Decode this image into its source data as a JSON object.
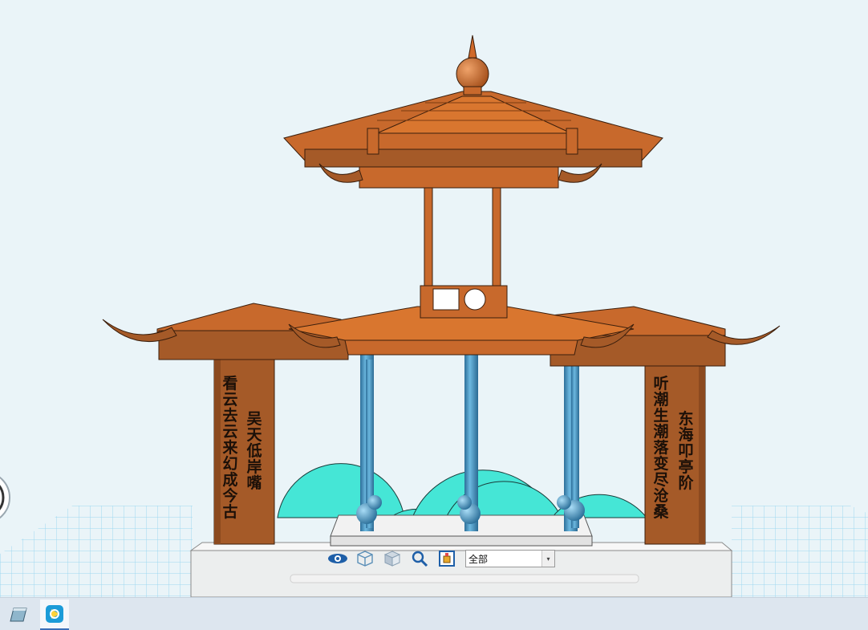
{
  "scene": {
    "model": "pavilion",
    "colors": {
      "background": "#eaf4f8",
      "roof": "#c8692c",
      "pillar_wood": "#a55a28",
      "column": "#3f8fbf",
      "hill": "#45e6d6",
      "grid": "#8fd3ee",
      "base": "#f0f2f2"
    },
    "couplets": {
      "left_outer": "看云去云来 幻成今古",
      "left_inner": "吴天低岸嘴",
      "right_outer": "听潮生潮落 变尽沧桑",
      "right_inner": "东海叩亭阶"
    }
  },
  "toolbar": {
    "buttons": [
      {
        "name": "view-eye",
        "icon": "eye-icon"
      },
      {
        "name": "wireframe-cube",
        "icon": "wire-cube-icon"
      },
      {
        "name": "solid-cube",
        "icon": "solid-cube-icon"
      },
      {
        "name": "zoom",
        "icon": "magnifier-icon"
      },
      {
        "name": "component",
        "icon": "component-icon"
      }
    ],
    "filter": {
      "selected": "全部"
    }
  },
  "taskbar": {
    "apps": [
      {
        "name": "notes-app",
        "icon": "notebook-icon"
      },
      {
        "name": "active-app",
        "icon": "media-app-icon"
      }
    ]
  }
}
